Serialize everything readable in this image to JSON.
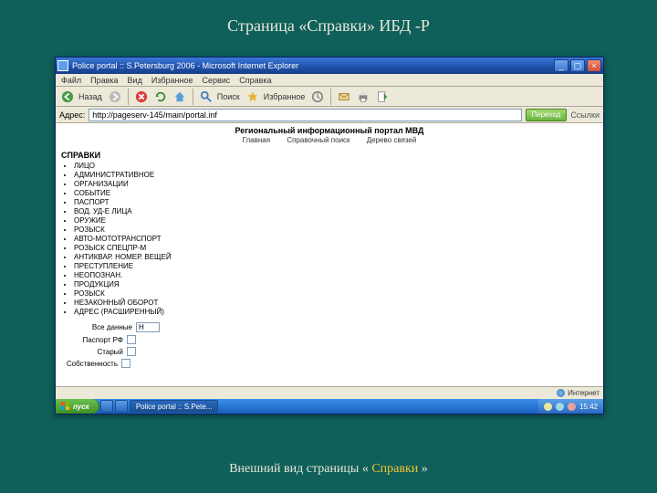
{
  "slide": {
    "title": "Страница «Справки» ИБД -Р",
    "caption_pre": "Внешний вид страницы  « ",
    "caption_em": "Справки",
    "caption_post": " »"
  },
  "window": {
    "title": "Police portal :: S.Petersburg 2006 - Microsoft Internet Explorer",
    "min": "_",
    "max": "▢",
    "close": "×"
  },
  "menu": [
    "Файл",
    "Правка",
    "Вид",
    "Избранное",
    "Сервис",
    "Справка"
  ],
  "toolbar": {
    "back": "Назад",
    "search": "Поиск",
    "fav": "Избранное"
  },
  "addr": {
    "label": "Адрес:",
    "value": "http://pageserv-145/main/portal.inf",
    "go": "Переход",
    "links": "Ссылки"
  },
  "portal": {
    "header": "Региональный информационный портал МВД",
    "tabs": [
      "Главная",
      "Справочный поиск",
      "Дерево связей"
    ],
    "section": "СПРАВКИ",
    "items": [
      "ЛИЦО",
      "АДМИНИСТРАТИВНОЕ",
      "ОРГАНИЗАЦИИ",
      "СОБЫТИЕ",
      "ПАСПОРТ",
      "ВОД. УД-Е ЛИЦА",
      "ОРУЖИЕ",
      "РОЗЫСК",
      "АВТО-МОТОТРАНСПОРТ",
      "РОЗЫСК СПЕЦПР-М",
      "АНТИКВАР. НОМЕР. ВЕЩЕЙ",
      "ПРЕСТУПЛЕНИЕ",
      "НЕОПОЗНАН.",
      "ПРОДУКЦИЯ",
      "РОЗЫСК",
      "НЕЗАКОННЫЙ ОБОРОТ",
      "АДРЕС (РАСШИРЕННЫЙ)"
    ],
    "form": {
      "all_label": "Все данные",
      "all_val": "Н",
      "passport_label": "Паспорт РФ",
      "old_label": "Старый",
      "own_label": "Собственность"
    }
  },
  "status": {
    "zone": "Интернет"
  },
  "taskbar": {
    "start": "пуск",
    "items": [
      "",
      "",
      "Police portal :: S.Pete..."
    ],
    "time": "15:42"
  }
}
